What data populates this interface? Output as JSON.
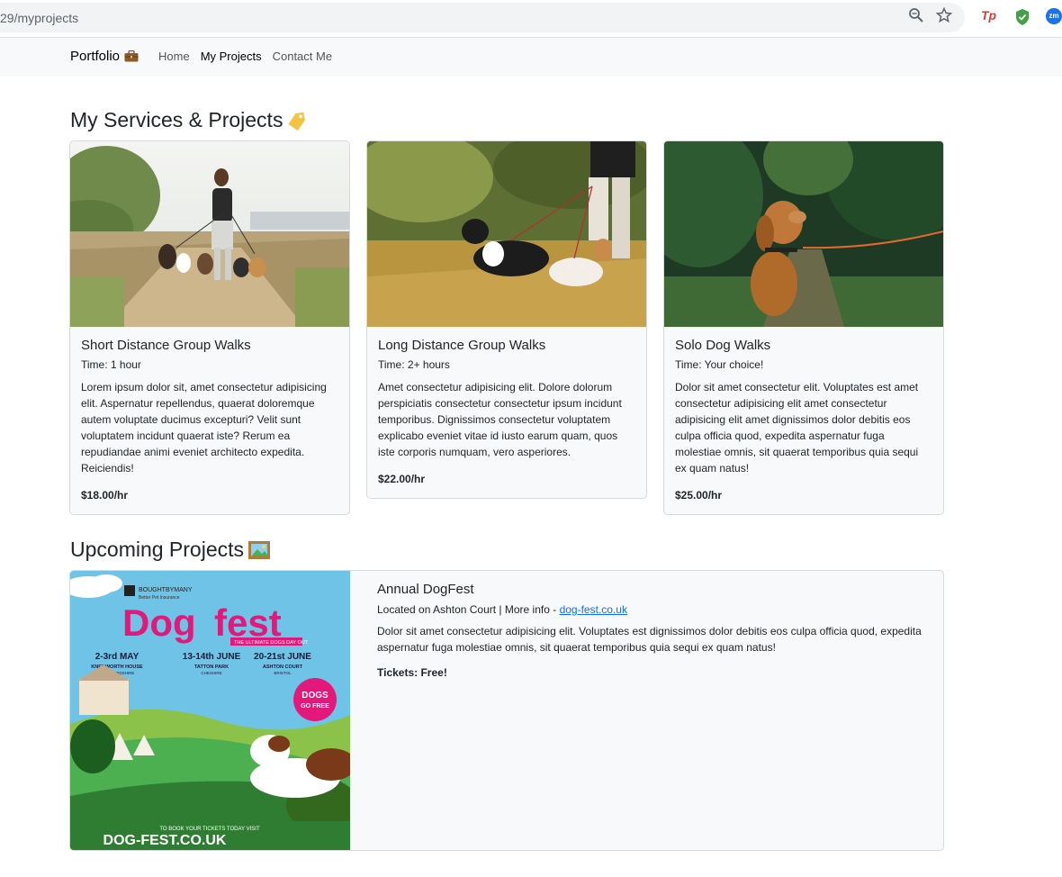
{
  "browser": {
    "url": "29/myprojects",
    "extensions": [
      "zoom-icon",
      "star-icon",
      "tp-extension",
      "shield-extension",
      "zm-extension"
    ],
    "tp_label": "Tp",
    "zm_label": "zm"
  },
  "navbar": {
    "brand": "Portfolio",
    "brand_icon": "briefcase-icon",
    "links": [
      {
        "label": "Home"
      },
      {
        "label": "My Projects"
      },
      {
        "label": "Contact Me"
      }
    ]
  },
  "services": {
    "heading": "My Services & Projects",
    "heading_icon": "tag-icon",
    "cards": [
      {
        "title": "Short Distance Group Walks",
        "time": "Time: 1 hour",
        "text": "Lorem ipsum dolor sit, amet consectetur adipisicing elit. Aspernatur repellendus, quaerat doloremque autem voluptate ducimus excepturi? Velit sunt voluptatem incidunt quaerat iste? Rerum ea repudiandae animi eveniet architecto expedita. Reiciendis!",
        "price": "$18.00/hr"
      },
      {
        "title": "Long Distance Group Walks",
        "time": "Time: 2+ hours",
        "text": "Amet consectetur adipisicing elit. Dolore dolorum perspiciatis consectetur consectetur ipsum incidunt temporibus. Dignissimos consectetur voluptatem explicabo eveniet vitae id iusto earum quam, quos iste corporis numquam, vero asperiores.",
        "price": "$22.00/hr"
      },
      {
        "title": "Solo Dog Walks",
        "time": "Time: Your choice!",
        "text": "Dolor sit amet consectetur elit. Voluptates est amet consectetur adipisicing elit amet consectetur adipisicing elit amet dignissimos dolor debitis eos culpa officia quod, expedita aspernatur fuga molestiae omnis, sit quaerat temporibus quia sequi ex quam natus!",
        "price": "$25.00/hr"
      }
    ]
  },
  "upcoming": {
    "heading": "Upcoming Projects",
    "heading_icon": "framed-picture-icon",
    "project": {
      "title": "Annual DogFest",
      "location_prefix": "Located on Ashton Court | More info - ",
      "link_text": "dog-fest.co.uk",
      "text": "Dolor sit amet consectetur adipisicing elit. Voluptates est dignissimos dolor debitis eos culpa officia quod, expedita aspernatur fuga molestiae omnis, sit quaerat temporibus quia sequi ex quam natus!",
      "tickets": "Tickets: Free!"
    },
    "poster": {
      "sponsor": "BOUGHTBYMANY",
      "sponsor_sub": "Better Pet Insurance",
      "logo_dog": "Dog",
      "logo_fest": "fest",
      "tagline": "THE ULTIMATE DOGS DAY OUT",
      "dates": [
        {
          "date": "2-3rd MAY",
          "place": "KNEBWORTH HOUSE",
          "county": "HERTFORDSHIRE"
        },
        {
          "date": "13-14th JUNE",
          "place": "TATTON PARK",
          "county": "CHESHIRE"
        },
        {
          "date": "20-21st JUNE",
          "place": "ASHTON COURT",
          "county": "BRISTOL"
        }
      ],
      "badge_line1": "DOGS",
      "badge_line2": "GO FREE",
      "book_line": "TO BOOK YOUR TICKETS TODAY VISIT",
      "site": "DOG-FEST.CO.UK"
    }
  }
}
